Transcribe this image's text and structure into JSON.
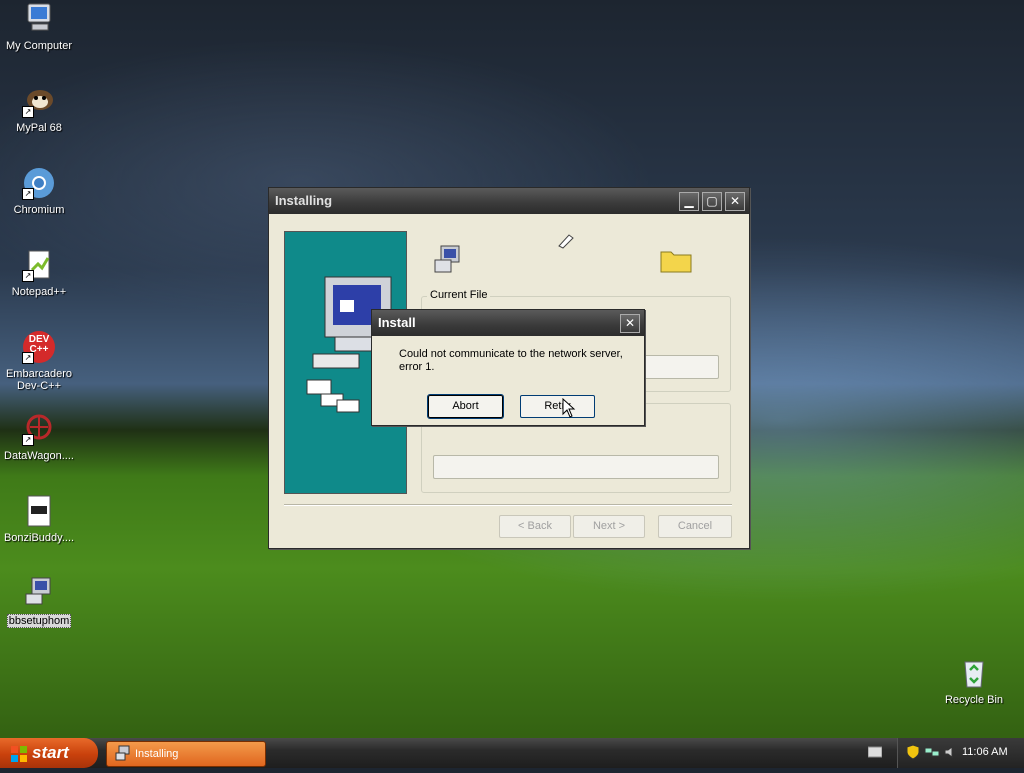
{
  "desktop": {
    "icons": [
      {
        "label": "My Computer",
        "icon": "my-computer-icon"
      },
      {
        "label": "MyPal 68",
        "icon": "mypal-browser-icon"
      },
      {
        "label": "Chromium",
        "icon": "chromium-icon"
      },
      {
        "label": "Notepad++",
        "icon": "notepad-plus-plus-icon"
      },
      {
        "label": "Embarcadero Dev-C++",
        "icon": "dev-cpp-icon",
        "badge": "DEV C++"
      },
      {
        "label": "DataWagon....",
        "icon": "datawagon-icon"
      },
      {
        "label": "BonziBuddy....",
        "icon": "bonzibuddy-file-icon"
      },
      {
        "label": "bbsetuphom",
        "icon": "setup-program-icon"
      },
      {
        "label": "Recycle Bin",
        "icon": "recycle-bin-icon"
      }
    ]
  },
  "installer": {
    "title": "Installing",
    "current_file_label": "Current File",
    "back_label": "< Back",
    "next_label": "Next >",
    "cancel_label": "Cancel"
  },
  "dialog": {
    "title": "Install",
    "message": "Could not communicate to the network server, error 1.",
    "abort_label": "Abort",
    "retry_label": "Retry"
  },
  "taskbar": {
    "start_label": "start",
    "task_item_label": "Installing",
    "clock": "11:06 AM"
  },
  "colors": {
    "teal_panel": "#0f8a8a",
    "start_button": "#d4531a",
    "title_bar": "#3b3b3b"
  }
}
